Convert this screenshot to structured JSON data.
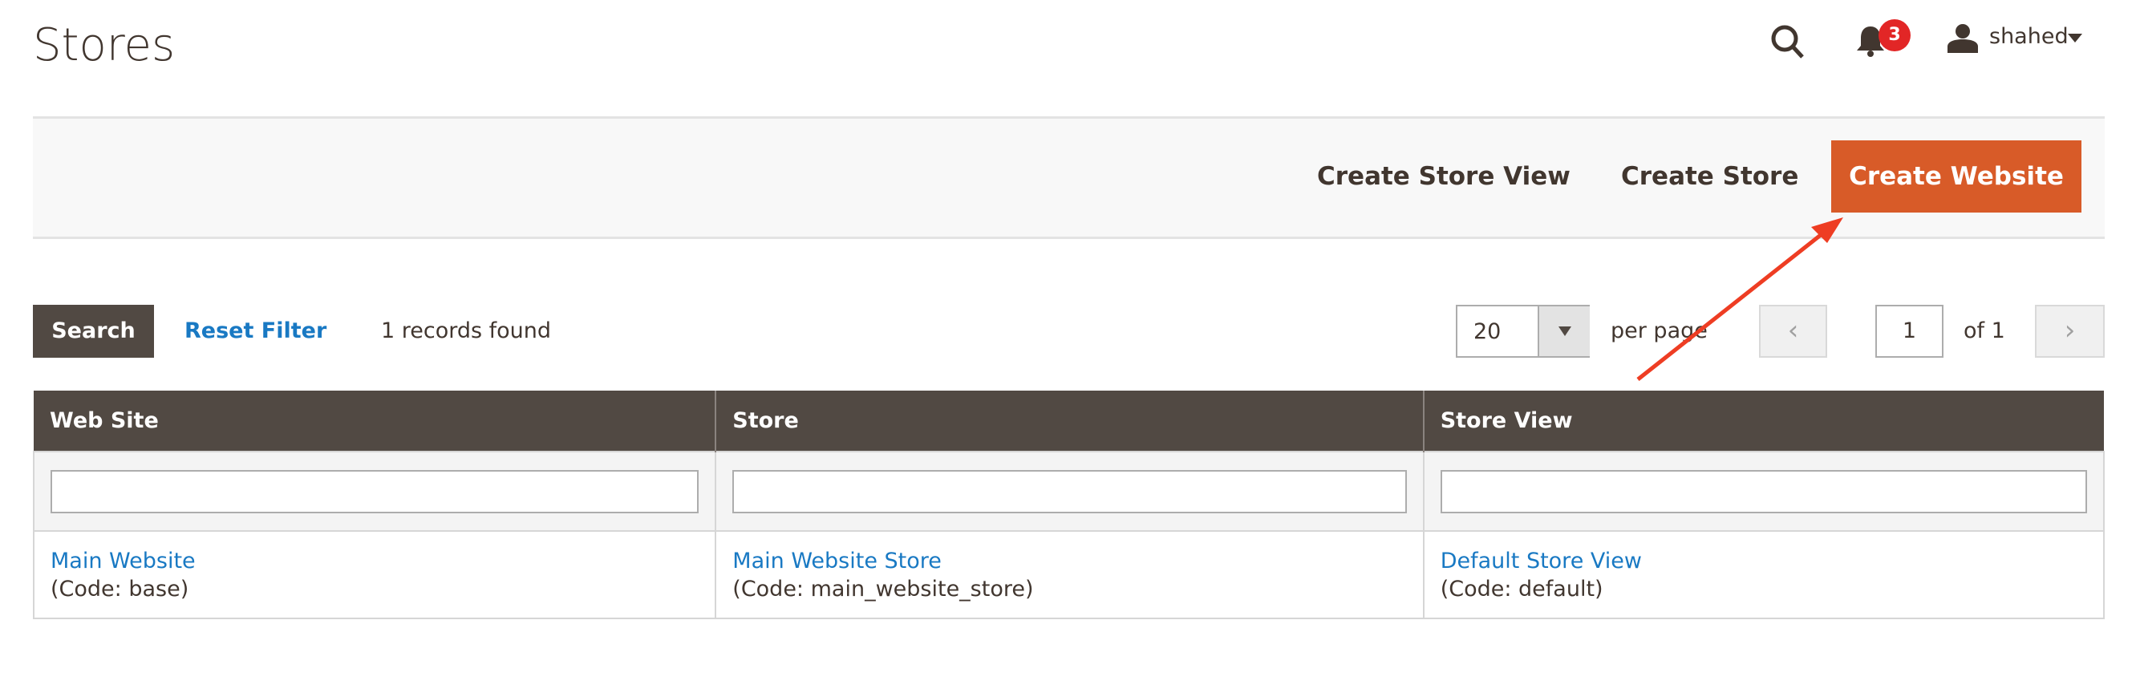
{
  "page": {
    "title": "Stores"
  },
  "header": {
    "notifications_count": "3",
    "username": "shahed"
  },
  "actions": {
    "create_store_view": "Create Store View",
    "create_store": "Create Store",
    "create_website": "Create Website",
    "accent": "#d85b28"
  },
  "grid": {
    "search_label": "Search",
    "reset_label": "Reset Filter",
    "records_found": "1 records found",
    "per_page_value": "20",
    "per_page_label": "per page",
    "page_value": "1",
    "page_total": "of 1",
    "columns": [
      "Web Site",
      "Store",
      "Store View"
    ],
    "rows": [
      {
        "website": "Main Website",
        "website_code": "(Code: base)",
        "store": "Main Website Store",
        "store_code": "(Code: main_website_store)",
        "store_view": "Default Store View",
        "store_view_code": "(Code: default)"
      }
    ]
  }
}
